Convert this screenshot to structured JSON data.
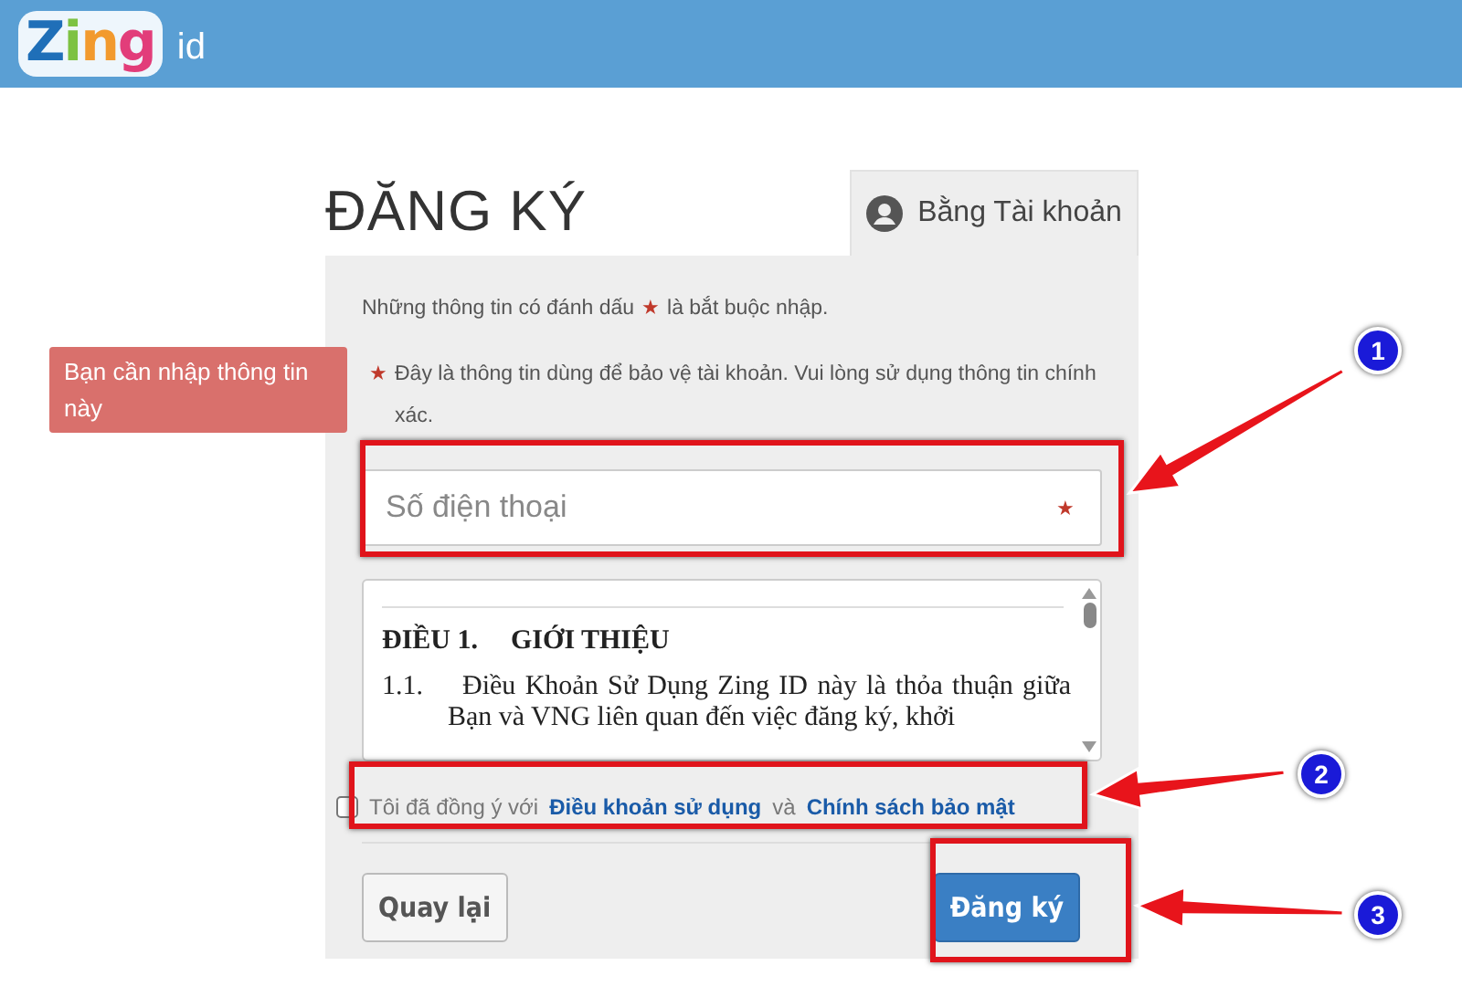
{
  "header": {
    "logo": "Zing",
    "suffix": "id"
  },
  "title": "ĐĂNG KÝ",
  "tab": {
    "label": "Bằng Tài khoản",
    "selected": true
  },
  "tooltip": "Bạn cần nhập thông tin này",
  "notes": [
    {
      "parts": [
        {
          "kind": "text",
          "text": "Những thông tin có đánh dấu"
        },
        {
          "kind": "star",
          "text": "★"
        },
        {
          "kind": "text",
          "text": "là bắt buộc nhập."
        }
      ]
    },
    {
      "parts": [
        {
          "kind": "star",
          "text": "★"
        },
        {
          "kind": "text",
          "text": "Đây là thông tin dùng để bảo vệ tài khoản. Vui lòng sử dụng thông tin chính xác."
        }
      ]
    }
  ],
  "phone_field": {
    "placeholder": "Số điện thoại",
    "required_mark": "★"
  },
  "terms": {
    "heading_number": "ĐIỀU 1.",
    "heading": "GIỚI THIỆU",
    "clause_number": "1.1.",
    "clause": "Điều Khoản Sử Dụng Zing ID này là thỏa thuận giữa Bạn và VNG liên quan đến việc đăng ký, khởi"
  },
  "agree": {
    "checked": false,
    "before": "Tôi đã đồng ý với",
    "link1": "Điều khoản sử dụng",
    "middle": "và",
    "link2": "Chính sách bảo mật"
  },
  "buttons": {
    "back": "Quay lại",
    "submit": "Đăng ký"
  },
  "annotations": [
    {
      "number": "1"
    },
    {
      "number": "2"
    },
    {
      "number": "3"
    }
  ]
}
